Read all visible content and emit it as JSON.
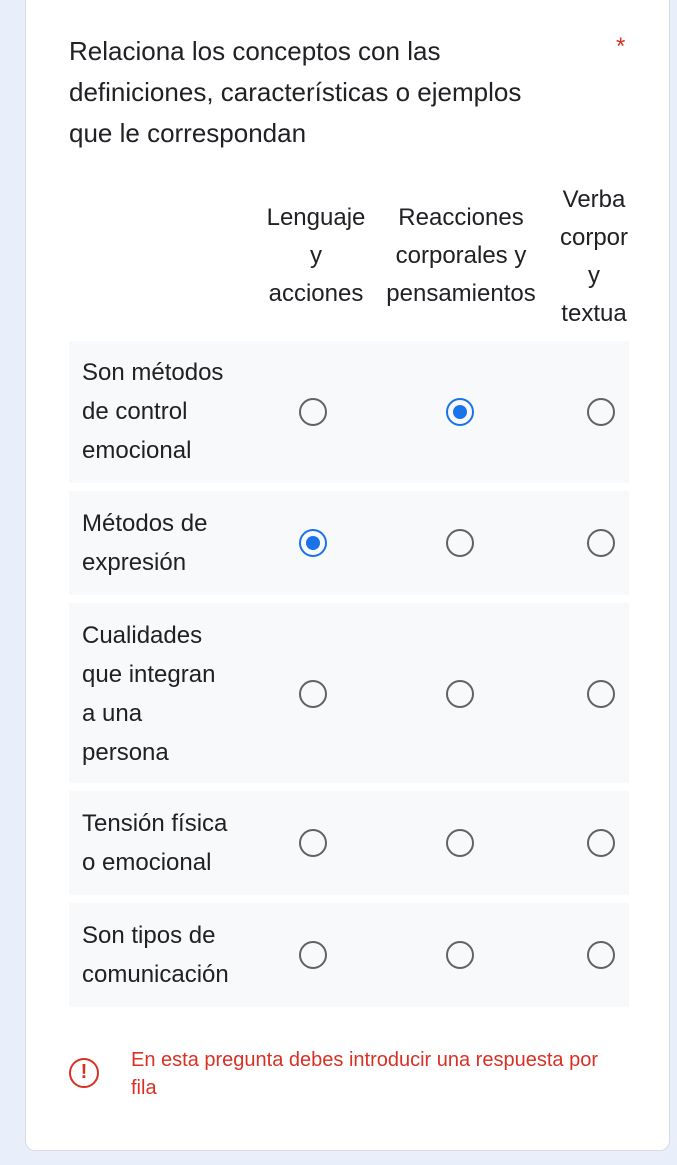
{
  "question": {
    "title": "Relaciona los conceptos con las definiciones, características o ejemplos que le correspondan",
    "required_mark": "*"
  },
  "columns": [
    "Lenguaje\ny\nacciones",
    "Reacciones\ncorporales y\npensamientos",
    "Verba\ncorpor\ny\ntextua"
  ],
  "rows": [
    {
      "label": "Son métodos\nde control\nemocional",
      "selected": 1
    },
    {
      "label": "Métodos de\nexpresión",
      "selected": 0
    },
    {
      "label": "Cualidades\nque integran\na una\npersona",
      "selected": null
    },
    {
      "label": "Tensión física\no emocional",
      "selected": null
    },
    {
      "label": "Son tipos de\ncomunicación",
      "selected": null
    }
  ],
  "error": {
    "icon": "error-icon",
    "message": "En esta pregunta debes introducir una respuesta por fila"
  },
  "colors": {
    "accent": "#1a73e8",
    "error": "#d93025"
  }
}
